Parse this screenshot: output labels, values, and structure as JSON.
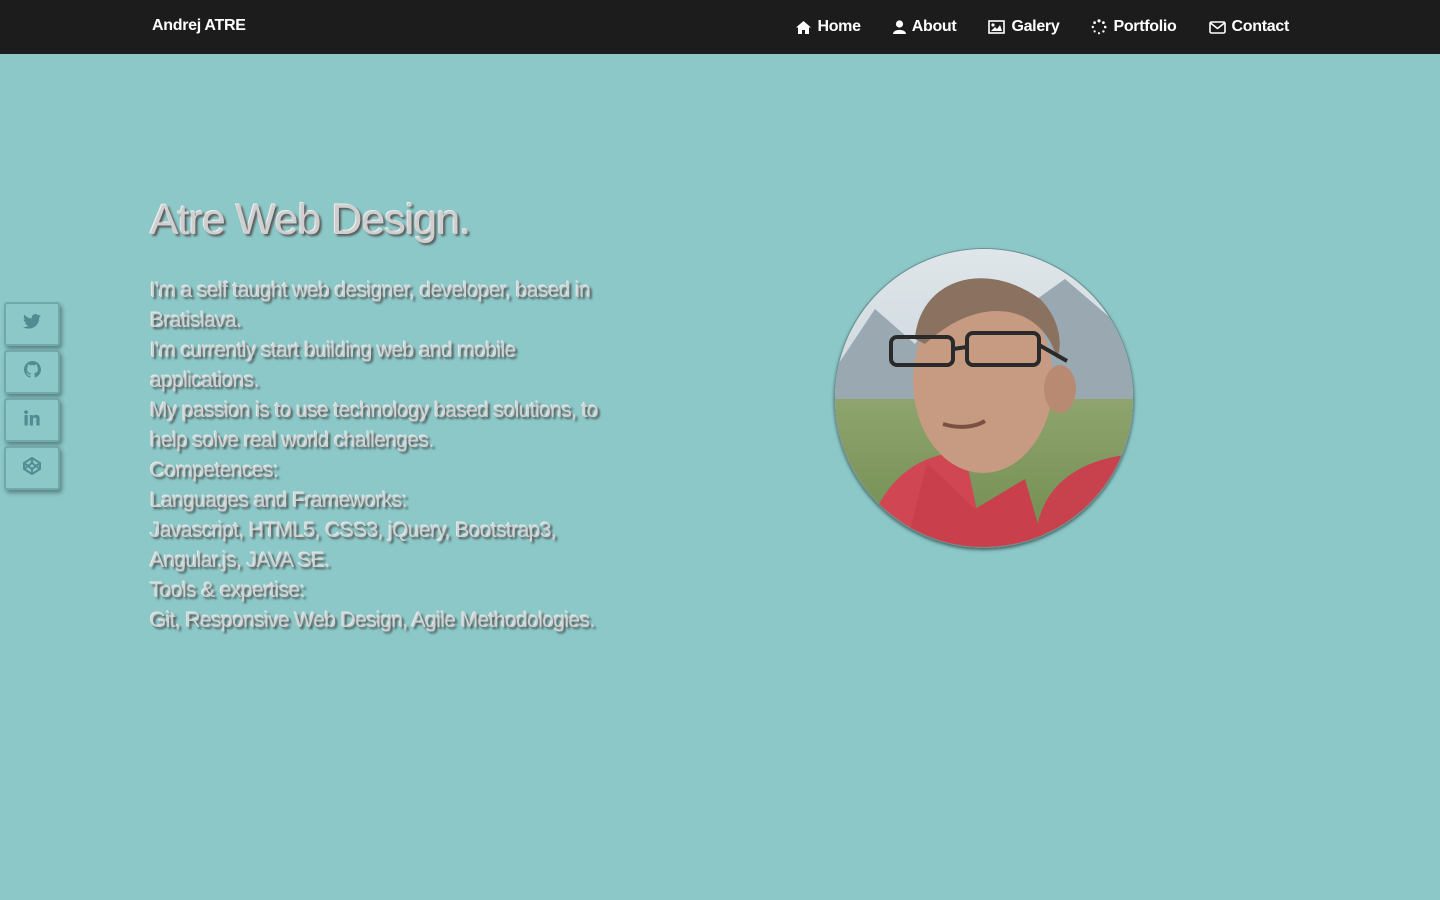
{
  "nav": {
    "brand": "Andrej ATRE",
    "items": [
      {
        "label": "Home",
        "icon": "home-icon"
      },
      {
        "label": "About",
        "icon": "user-icon"
      },
      {
        "label": "Galery",
        "icon": "picture-icon"
      },
      {
        "label": "Portfolio",
        "icon": "spinner-icon"
      },
      {
        "label": "Contact",
        "icon": "envelope-icon"
      }
    ]
  },
  "social": [
    {
      "icon": "twitter-icon"
    },
    {
      "icon": "github-icon"
    },
    {
      "icon": "linkedin-icon"
    },
    {
      "icon": "codepen-icon"
    }
  ],
  "hero": {
    "title": "Atre Web Design.",
    "lines": [
      "I'm a self taught web designer, developer, based in Bratislava.",
      "I'm currently start building web and mobile applications.",
      "My passion is to use technology based solutions, to help solve real world challenges.",
      "Competences:",
      "Languages and Frameworks:",
      "Javascript, HTML5, CSS3, jQuery, Bootstrap3, Angular.js, JAVA SE.",
      "Tools & expertise:",
      "Git, Responsive Web Design, Agile Methodologies."
    ]
  },
  "colors": {
    "background": "#8cc8c8",
    "navbar": "#1c1c1c",
    "icon": "#4f8d92"
  }
}
